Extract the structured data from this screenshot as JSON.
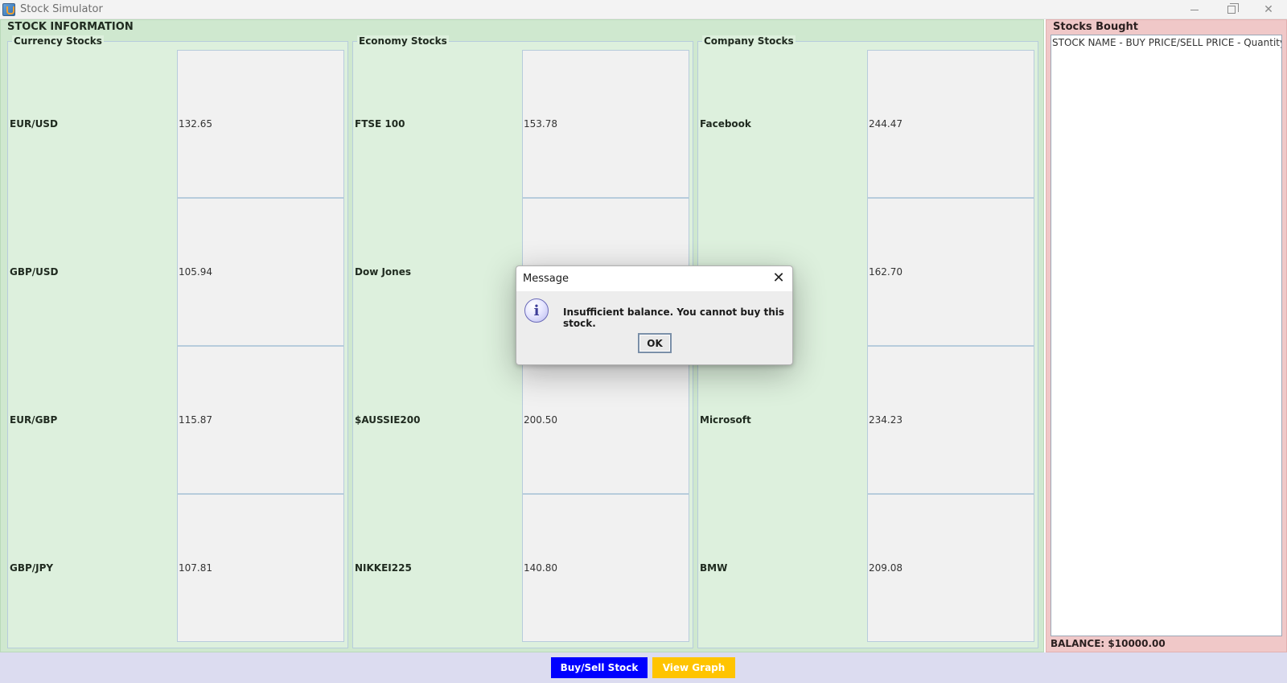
{
  "window": {
    "title": "Stock Simulator"
  },
  "stock_info": {
    "title": "STOCK INFORMATION",
    "groups": [
      {
        "title": "Currency Stocks",
        "rows": [
          {
            "name": "EUR/USD",
            "price": "132.65"
          },
          {
            "name": "GBP/USD",
            "price": "105.94"
          },
          {
            "name": "EUR/GBP",
            "price": "115.87"
          },
          {
            "name": "GBP/JPY",
            "price": "107.81"
          }
        ]
      },
      {
        "title": "Economy Stocks",
        "rows": [
          {
            "name": "FTSE 100",
            "price": "153.78"
          },
          {
            "name": "Dow Jones",
            "price": ""
          },
          {
            "name": "$AUSSIE200",
            "price": "200.50"
          },
          {
            "name": "NIKKEI225",
            "price": "140.80"
          }
        ]
      },
      {
        "title": "Company Stocks",
        "rows": [
          {
            "name": "Facebook",
            "price": "244.47"
          },
          {
            "name": "",
            "price": "162.70"
          },
          {
            "name": "Microsoft",
            "price": "234.23"
          },
          {
            "name": "BMW",
            "price": "209.08"
          }
        ]
      }
    ]
  },
  "bought": {
    "title": "Stocks Bought",
    "header_line": "STOCK NAME - BUY PRICE/SELL PRICE - Quantity",
    "balance": "BALANCE: $10000.00"
  },
  "buttons": {
    "buy_sell": "Buy/Sell Stock",
    "view_graph": "View Graph"
  },
  "dialog": {
    "title": "Message",
    "message": "Insufficient balance. You cannot buy this stock.",
    "ok": "OK",
    "close_glyph": "✕"
  }
}
